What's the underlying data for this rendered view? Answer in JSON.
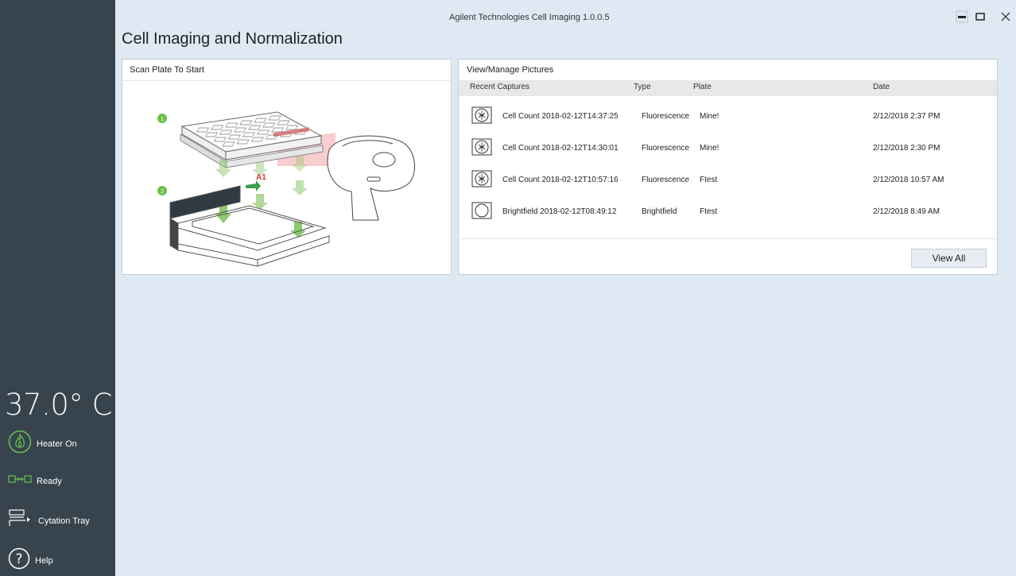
{
  "window": {
    "app_title": "Agilent Technologies Cell Imaging 1.0.0.5",
    "minimize_icon": "minimize-icon",
    "maximize_icon": "maximize-icon",
    "close_icon": "close-icon"
  },
  "page": {
    "title": "Cell Imaging and Normalization"
  },
  "sidebar": {
    "temperature": "37.0° C",
    "heater_label": "Heater On",
    "ready_label": "Ready",
    "tray_label": "Cytation Tray",
    "help_label": "Help",
    "accent_green": "#6cc04a"
  },
  "scan_panel": {
    "title": "Scan Plate To Start",
    "step1": "1",
    "step2": "2",
    "a1_label": "A1"
  },
  "pictures_panel": {
    "title": "View/Manage Pictures",
    "columns": {
      "recent": "Recent Captures",
      "type": "Type",
      "plate": "Plate",
      "date": "Date"
    },
    "rows": [
      {
        "name": "Cell Count 2018-02-12T14:37:25",
        "type": "Fluorescence",
        "plate": "Mine!",
        "date": "2/12/2018 2:37 PM",
        "icon": "fluorescence-icon"
      },
      {
        "name": "Cell Count 2018-02-12T14:30:01",
        "type": "Fluorescence",
        "plate": "Mine!",
        "date": "2/12/2018 2:30 PM",
        "icon": "fluorescence-icon"
      },
      {
        "name": "Cell Count 2018-02-12T10:57:16",
        "type": "Fluorescence",
        "plate": "Ftest",
        "date": "2/12/2018 10:57 AM",
        "icon": "fluorescence-icon"
      },
      {
        "name": "Brightfield 2018-02-12T08:49:12",
        "type": "Brightfield",
        "plate": "Ftest",
        "date": "2/12/2018 8:49 AM",
        "icon": "brightfield-icon"
      }
    ],
    "view_all_label": "View All"
  }
}
